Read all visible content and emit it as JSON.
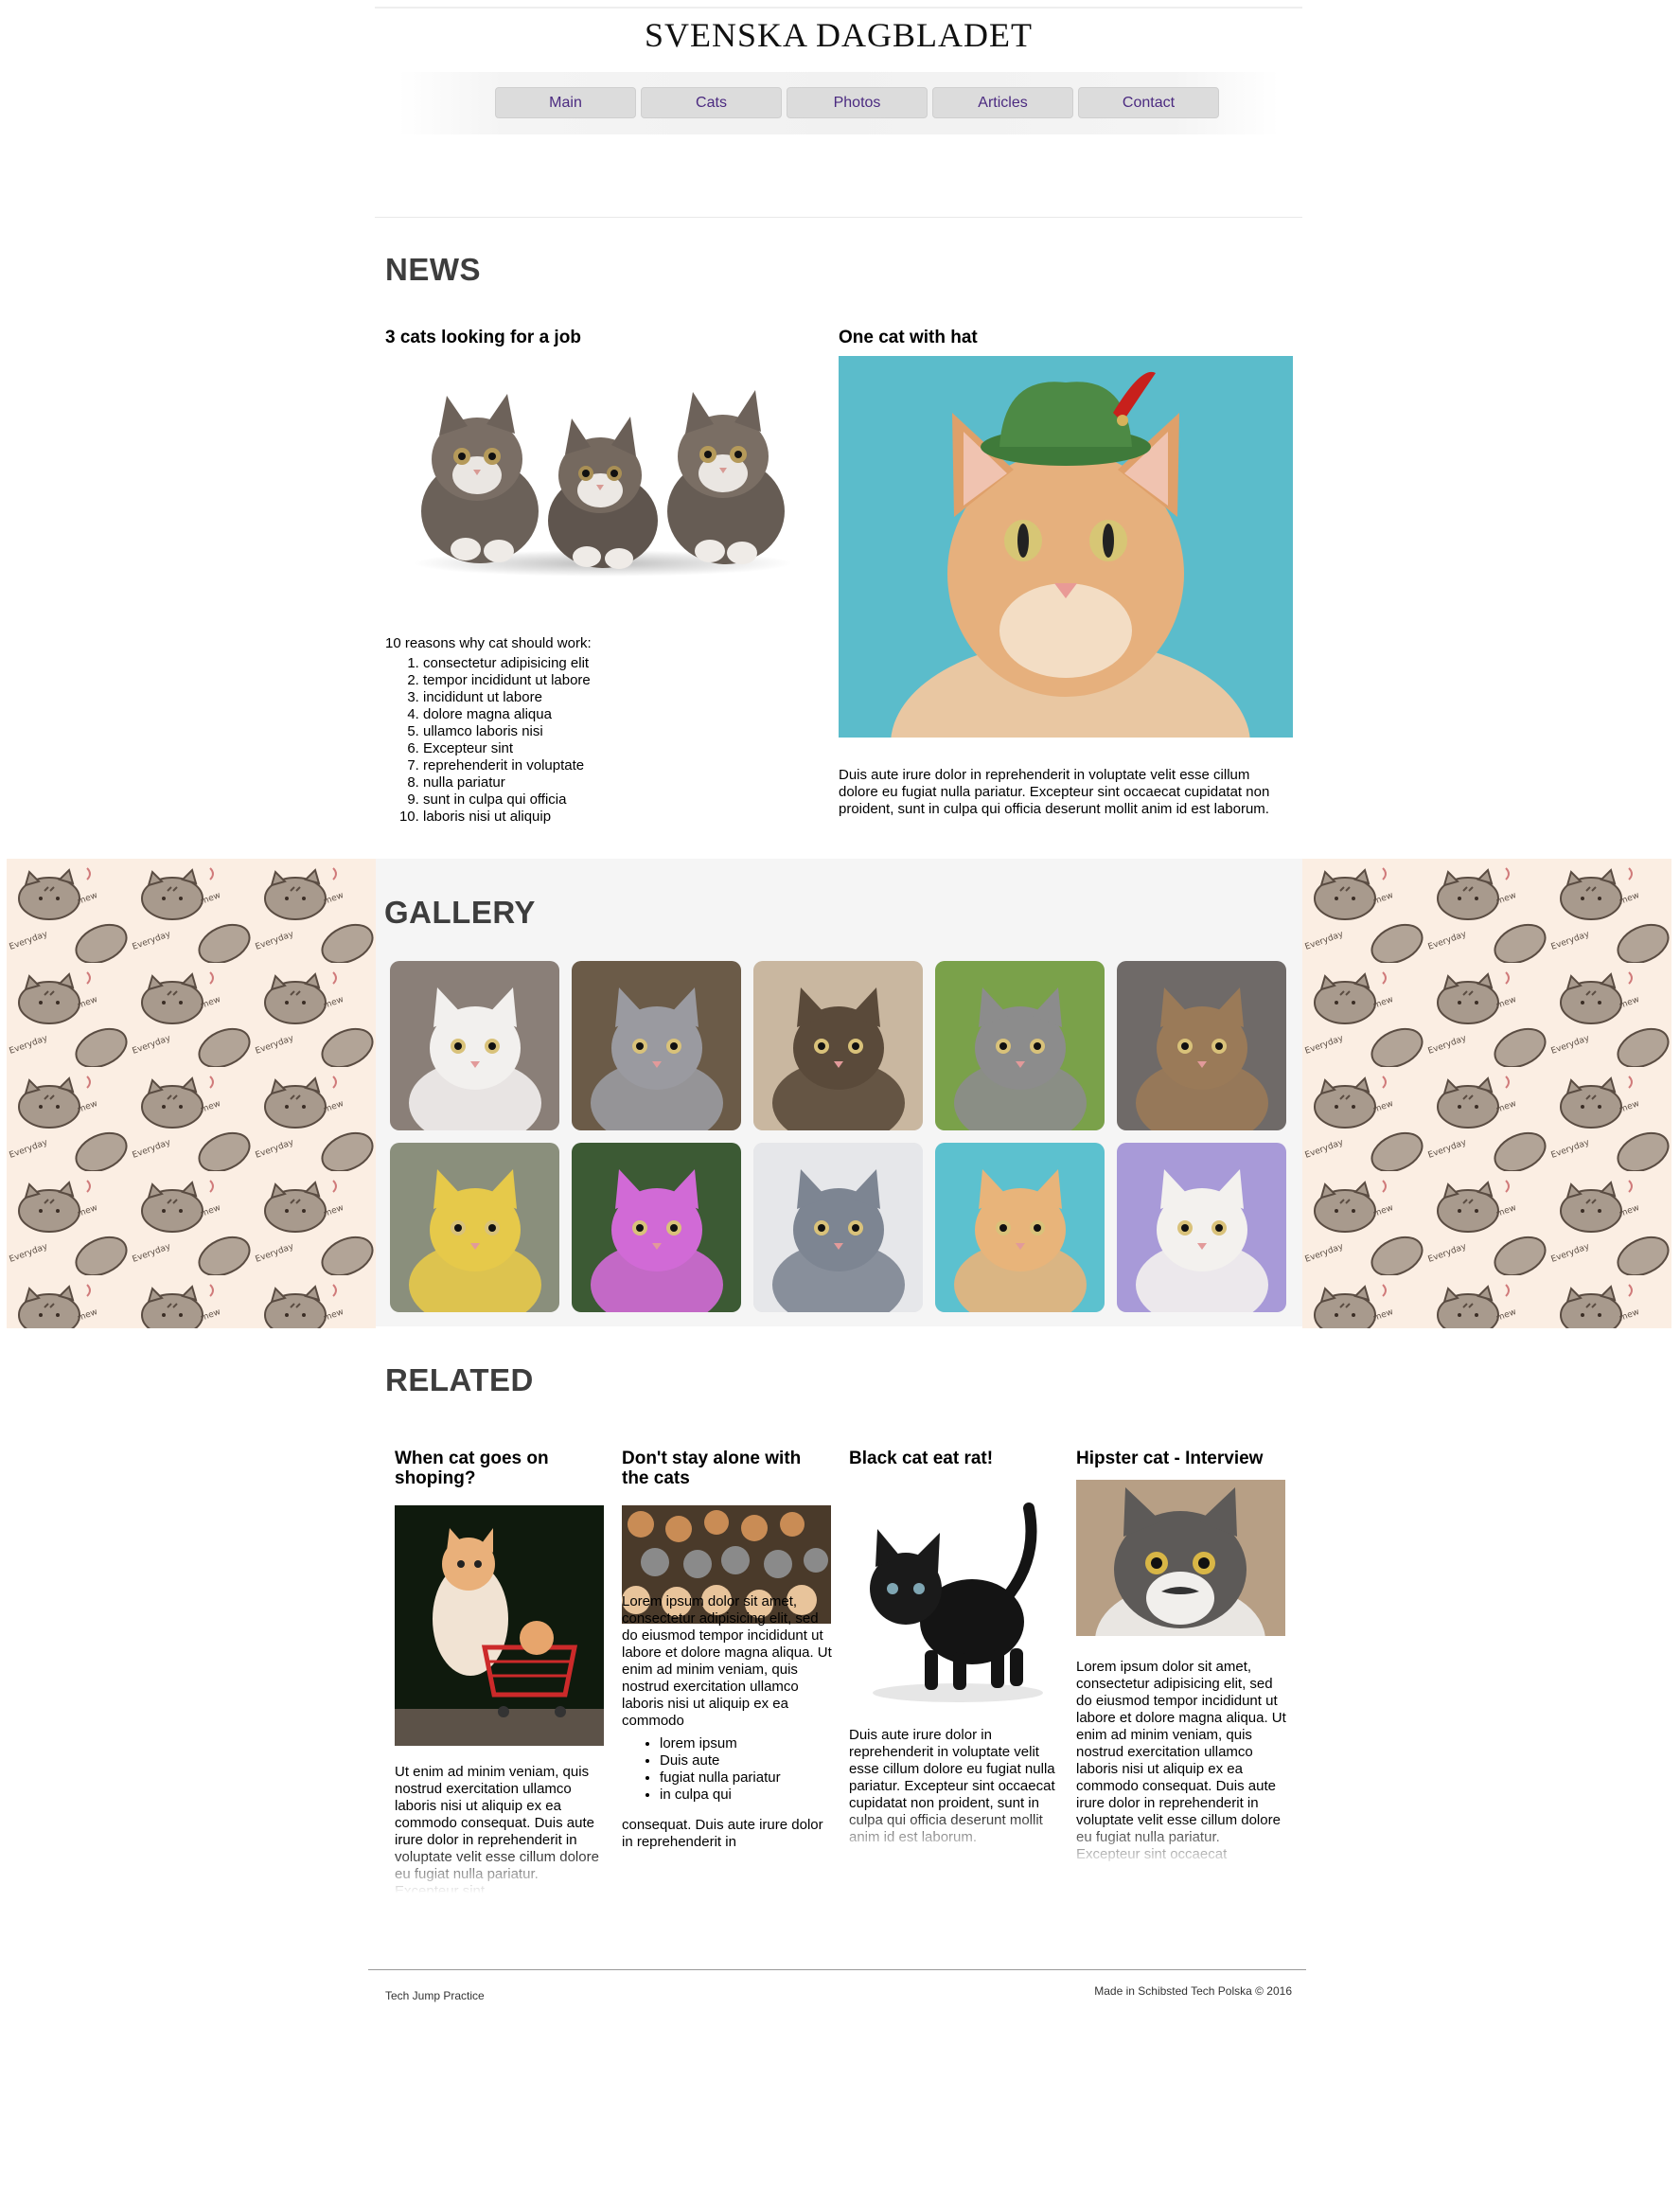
{
  "header": {
    "site_title": "SVENSKA DAGBLADET",
    "nav": [
      "Main",
      "Cats",
      "Photos",
      "Articles",
      "Contact"
    ]
  },
  "news": {
    "title": "NEWS",
    "left": {
      "heading": "3 cats looking for a job",
      "intro": "10 reasons why cat should work:",
      "list": [
        "consectetur adipisicing elit",
        "tempor incididunt ut labore",
        "incididunt ut labore",
        "dolore magna aliqua",
        "ullamco laboris nisi",
        "Excepteur sint",
        "reprehenderit in voluptate",
        "nulla pariatur",
        "sunt in culpa qui officia",
        "laboris nisi ut aliquip"
      ]
    },
    "right": {
      "heading": "One cat with hat",
      "body": "Duis aute irure dolor in reprehenderit in voluptate velit esse cillum dolore eu fugiat nulla pariatur. Excepteur sint occaecat cupidatat non proident, sunt in culpa qui officia deserunt mollit anim id est laborum."
    }
  },
  "gallery": {
    "title": "GALLERY",
    "pattern_words": [
      "Everyday",
      "mew",
      "cute",
      "Pusheen",
      "z z"
    ],
    "tiles": [
      {
        "name": "white-cat-photo",
        "bg": "#8a7f78",
        "cat": "#f2f0ee"
      },
      {
        "name": "grey-white-cat-photo",
        "bg": "#6b5b48",
        "cat": "#9a9aa0"
      },
      {
        "name": "bowtie-kitten-photo",
        "bg": "#c9b7a0",
        "cat": "#5a4a3a"
      },
      {
        "name": "kitten-on-ball-photo",
        "bg": "#7aa14a",
        "cat": "#8c8c8c"
      },
      {
        "name": "tabby-cat-photo",
        "bg": "#6f6a68",
        "cat": "#9a7a58"
      },
      {
        "name": "kitten-yellow-hood-photo",
        "bg": "#8a8f7c",
        "cat": "#e6c94a"
      },
      {
        "name": "colorful-kittens-photo",
        "bg": "#3c5a34",
        "cat": "#d16ad6"
      },
      {
        "name": "grey-persian-photo",
        "bg": "#e6e7ea",
        "cat": "#7d8592"
      },
      {
        "name": "propeller-hat-cat-photo",
        "bg": "#5cc1cf",
        "cat": "#e8b47a"
      },
      {
        "name": "flat-cap-cat-photo",
        "bg": "#a89ad8",
        "cat": "#f3f1ee"
      }
    ]
  },
  "related": {
    "title": "RELATED",
    "articles": [
      {
        "heading": "When cat goes on shoping?",
        "body": "Ut enim ad minim veniam, quis nostrud exercitation ullamco laboris nisi ut aliquip ex ea commodo consequat. Duis aute irure dolor in reprehenderit in voluptate velit esse cillum dolore eu fugiat nulla pariatur. Excepteur sint"
      },
      {
        "heading": "Don't stay alone with the cats",
        "body": "Lorem ipsum dolor sit amet, consectetur adipisicing elit, sed do eiusmod tempor incididunt ut labore et dolore magna aliqua. Ut enim ad minim veniam, quis nostrud exercitation ullamco laboris nisi ut aliquip ex ea commodo",
        "list": [
          "lorem ipsum",
          "Duis aute",
          "fugiat nulla pariatur",
          "in culpa qui"
        ],
        "tail": "consequat. Duis aute irure dolor in reprehenderit in"
      },
      {
        "heading": "Black cat eat rat!",
        "body": "Duis aute irure dolor in reprehenderit in voluptate velit esse cillum dolore eu fugiat nulla pariatur. Excepteur sint occaecat cupidatat non proident, sunt in culpa qui officia deserunt mollit anim id est laborum."
      },
      {
        "heading": "Hipster cat - Interview",
        "body": "Lorem ipsum dolor sit amet, consectetur adipisicing elit, sed do eiusmod tempor incididunt ut labore et dolore magna aliqua. Ut enim ad minim veniam, quis nostrud exercitation ullamco laboris nisi ut aliquip ex ea commodo consequat. Duis aute irure dolor in reprehenderit in voluptate velit esse cillum dolore eu fugiat nulla pariatur. Excepteur sint occaecat cupidatat non proident, sunt in"
      }
    ]
  },
  "footer": {
    "left": "Tech Jump Practice",
    "right": "Made in Schibsted Tech Polska © 2016"
  },
  "colors": {
    "nav_text": "#4b2a80",
    "heading": "#3d3d3d",
    "pattern_bg": "#fbeee3"
  }
}
